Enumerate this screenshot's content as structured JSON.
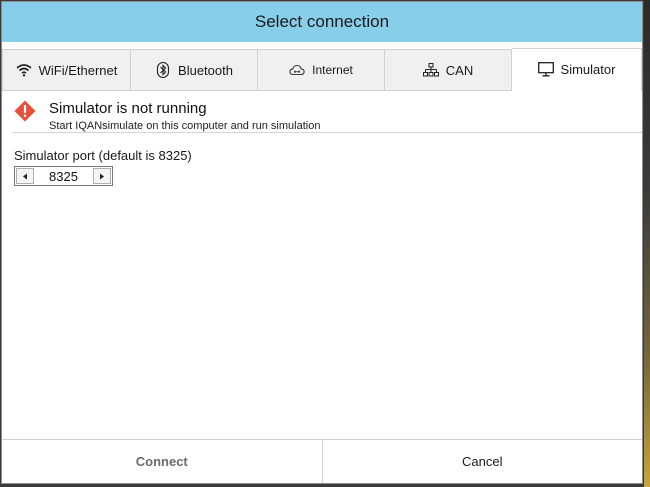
{
  "dialog": {
    "title": "Select connection"
  },
  "tabs": [
    {
      "label": "WiFi/Ethernet",
      "icon": "wifi-icon",
      "active": false
    },
    {
      "label": "Bluetooth",
      "icon": "bluetooth-icon",
      "active": false
    },
    {
      "label": "Internet",
      "icon": "cloud-icon",
      "active": false
    },
    {
      "label": "CAN",
      "icon": "network-icon",
      "active": false
    },
    {
      "label": "Simulator",
      "icon": "monitor-icon",
      "active": true
    }
  ],
  "alert": {
    "title": "Simulator is not running",
    "message": "Start IQANsimulate on this computer and run simulation",
    "icon": "warning-icon",
    "color": "#e8503a"
  },
  "port": {
    "label": "Simulator port (default is 8325)",
    "value": "8325"
  },
  "footer": {
    "connect_label": "Connect",
    "cancel_label": "Cancel"
  },
  "colors": {
    "titlebar": "#87ceeb",
    "warning": "#e8503a"
  }
}
